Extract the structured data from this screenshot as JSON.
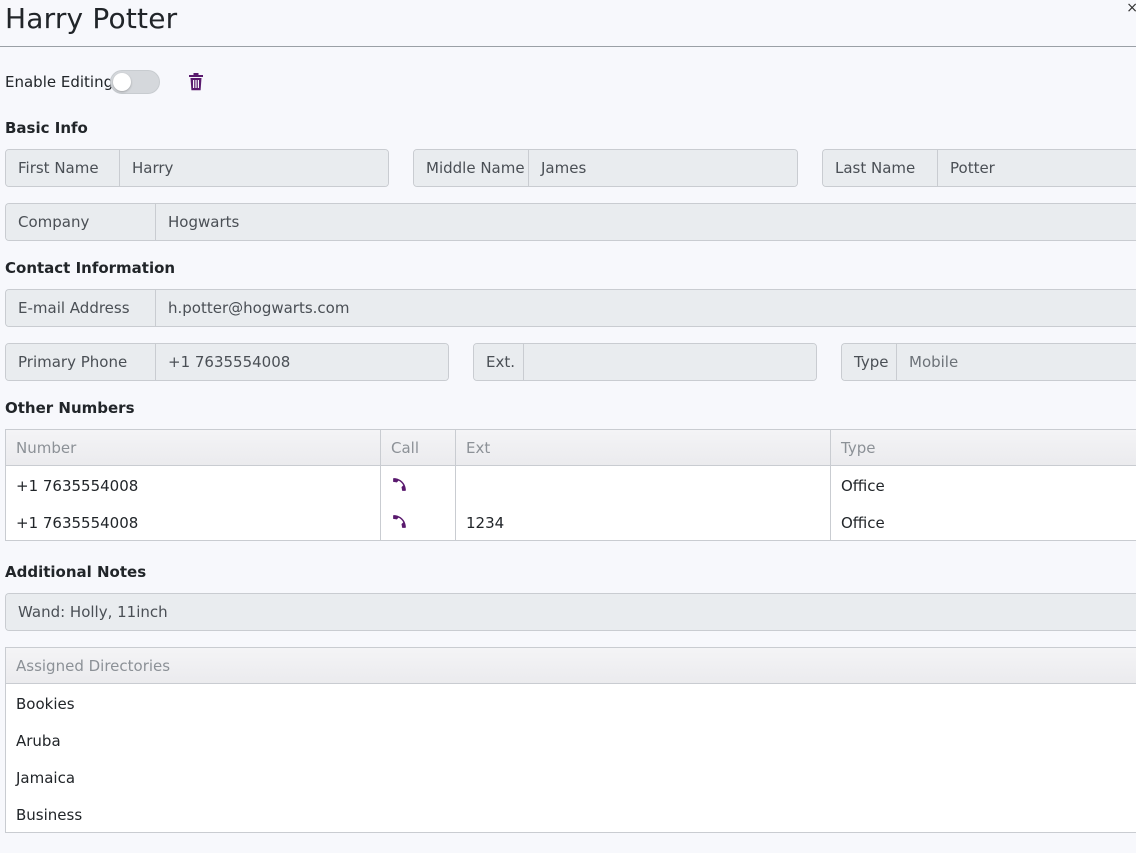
{
  "header": {
    "title": "Harry Potter",
    "close_glyph": "×"
  },
  "toolbar": {
    "enable_editing_label": "Enable Editing",
    "enable_editing_on": false,
    "delete_icon": "trash-icon",
    "accent_color": "#5a1a6e"
  },
  "basic_info": {
    "section_title": "Basic Info",
    "first_name": {
      "label": "First Name",
      "value": "Harry"
    },
    "middle_name": {
      "label": "Middle Name",
      "value": "James"
    },
    "last_name": {
      "label": "Last Name",
      "value": "Potter"
    },
    "company": {
      "label": "Company",
      "value": "Hogwarts"
    }
  },
  "contact": {
    "section_title": "Contact Information",
    "email": {
      "label": "E-mail Address",
      "value": "h.potter@hogwarts.com"
    },
    "primary_phone": {
      "label": "Primary Phone",
      "value": "+1 7635554008"
    },
    "ext": {
      "label": "Ext.",
      "value": ""
    },
    "type": {
      "label": "Type",
      "value": "Mobile"
    }
  },
  "other_numbers": {
    "section_title": "Other Numbers",
    "columns": [
      "Number",
      "Call",
      "Ext",
      "Type"
    ],
    "rows": [
      {
        "number": "+1 7635554008",
        "call_icon": "phone-icon",
        "ext": "",
        "type": "Office"
      },
      {
        "number": "+1 7635554008",
        "call_icon": "phone-icon",
        "ext": "1234",
        "type": "Office"
      }
    ]
  },
  "notes": {
    "section_title": "Additional Notes",
    "value": "Wand: Holly, 11inch"
  },
  "directories": {
    "header": "Assigned Directories",
    "items": [
      "Bookies",
      "Aruba",
      "Jamaica",
      "Business"
    ]
  }
}
